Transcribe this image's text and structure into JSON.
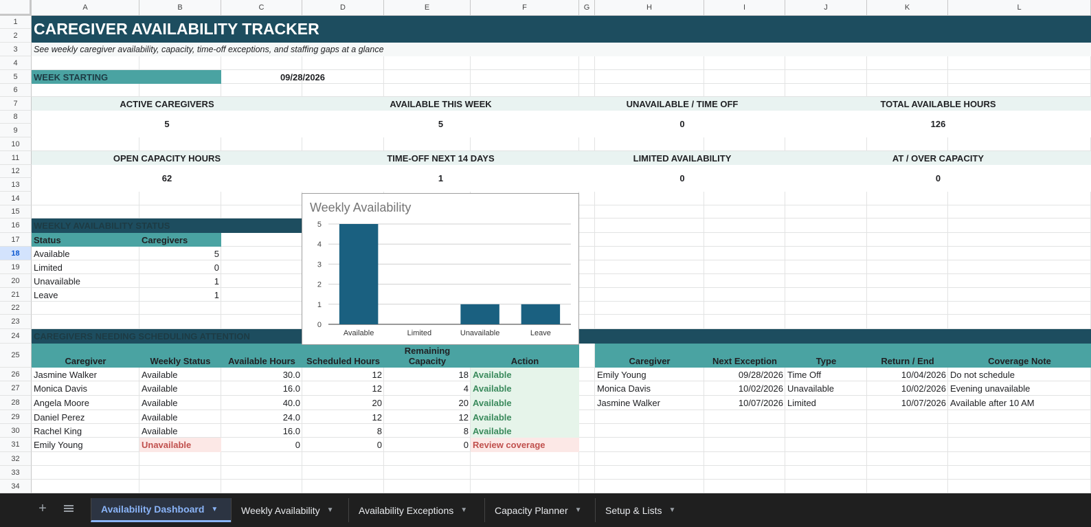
{
  "columns": [
    "A",
    "B",
    "C",
    "D",
    "E",
    "F",
    "G",
    "H",
    "I",
    "J",
    "K",
    "L"
  ],
  "rows": [
    "1",
    "2",
    "3",
    "4",
    "5",
    "6",
    "7",
    "8",
    "9",
    "10",
    "11",
    "12",
    "13",
    "14",
    "15",
    "16",
    "17",
    "18",
    "19",
    "20",
    "21",
    "22",
    "23",
    "24",
    "25",
    "26",
    "27",
    "28",
    "29",
    "30",
    "31",
    "32",
    "33",
    "34"
  ],
  "selected_row": "18",
  "title": "CAREGIVER AVAILABILITY TRACKER",
  "subtitle": "See weekly caregiver availability, capacity, time-off exceptions, and staffing gaps at a glance",
  "week": {
    "label": "WEEK STARTING",
    "value": "09/28/2026"
  },
  "kpis_row1": [
    {
      "label": "ACTIVE CAREGIVERS",
      "value": "5"
    },
    {
      "label": "AVAILABLE THIS WEEK",
      "value": "5"
    },
    {
      "label": "UNAVAILABLE / TIME OFF",
      "value": "0"
    },
    {
      "label": "TOTAL AVAILABLE HOURS",
      "value": "126"
    }
  ],
  "kpis_row2": [
    {
      "label": "OPEN CAPACITY HOURS",
      "value": "62"
    },
    {
      "label": "TIME-OFF NEXT 14 DAYS",
      "value": "1"
    },
    {
      "label": "LIMITED AVAILABILITY",
      "value": "0"
    },
    {
      "label": "AT / OVER CAPACITY",
      "value": "0"
    }
  ],
  "status_section": {
    "title": "WEEKLY AVAILABILITY STATUS",
    "headers": [
      "Status",
      "Caregivers"
    ],
    "rows": [
      {
        "status": "Available",
        "count": "5"
      },
      {
        "status": "Limited",
        "count": "0"
      },
      {
        "status": "Unavailable",
        "count": "1"
      },
      {
        "status": "Leave",
        "count": "1"
      }
    ]
  },
  "chart_data": {
    "type": "bar",
    "title": "Weekly Availability",
    "categories": [
      "Available",
      "Limited",
      "Unavailable",
      "Leave"
    ],
    "values": [
      5,
      0,
      1,
      1
    ],
    "ylim": [
      0,
      5
    ],
    "yticks": [
      "0",
      "1",
      "2",
      "3",
      "4",
      "5"
    ],
    "grid": true,
    "bar_color": "#1a6080"
  },
  "attention_section": {
    "title": "CAREGIVERS NEEDING SCHEDULING ATTENTION",
    "headers": [
      "Caregiver",
      "Weekly Status",
      "Available Hours",
      "Scheduled Hours",
      "Remaining Capacity",
      "Action"
    ],
    "rows": [
      {
        "name": "Jasmine Walker",
        "status": "Available",
        "available": "30.0",
        "scheduled": "12",
        "remaining": "18",
        "action": "Available",
        "flag": "ok"
      },
      {
        "name": "Monica Davis",
        "status": "Available",
        "available": "16.0",
        "scheduled": "12",
        "remaining": "4",
        "action": "Available",
        "flag": "ok"
      },
      {
        "name": "Angela Moore",
        "status": "Available",
        "available": "40.0",
        "scheduled": "20",
        "remaining": "20",
        "action": "Available",
        "flag": "ok"
      },
      {
        "name": "Daniel Perez",
        "status": "Available",
        "available": "24.0",
        "scheduled": "12",
        "remaining": "12",
        "action": "Available",
        "flag": "ok"
      },
      {
        "name": "Rachel King",
        "status": "Available",
        "available": "16.0",
        "scheduled": "8",
        "remaining": "8",
        "action": "Available",
        "flag": "ok"
      },
      {
        "name": "Emily Young",
        "status": "Unavailable",
        "available": "0",
        "scheduled": "0",
        "remaining": "0",
        "action": "Review coverage",
        "flag": "warn"
      }
    ]
  },
  "exceptions": {
    "headers": [
      "Caregiver",
      "Next Exception",
      "Type",
      "Return / End",
      "Coverage Note"
    ],
    "rows": [
      {
        "name": "Emily Young",
        "date": "09/28/2026",
        "type": "Time Off",
        "end": "10/04/2026",
        "note": "Do not schedule"
      },
      {
        "name": "Monica Davis",
        "date": "10/02/2026",
        "type": "Unavailable",
        "end": "10/02/2026",
        "note": "Evening unavailable"
      },
      {
        "name": "Jasmine Walker",
        "date": "10/07/2026",
        "type": "Limited",
        "end": "10/07/2026",
        "note": "Available after 10 AM"
      }
    ]
  },
  "sheet_tabs": [
    {
      "label": "Availability Dashboard",
      "active": true
    },
    {
      "label": "Weekly Availability",
      "active": false
    },
    {
      "label": "Availability Exceptions",
      "active": false
    },
    {
      "label": "Capacity Planner",
      "active": false
    },
    {
      "label": "Setup & Lists",
      "active": false
    }
  ],
  "icons": {
    "add_sheet": "plus-icon",
    "all_sheets": "menu-icon",
    "tab_menu": "caret-down-icon"
  },
  "colors": {
    "title_bar": "#1d4d5f",
    "header_teal": "#4aa3a2",
    "kpi_bg": "#e9f3f1",
    "ok_text": "#3a8a5c",
    "warn_text": "#c0504d"
  }
}
